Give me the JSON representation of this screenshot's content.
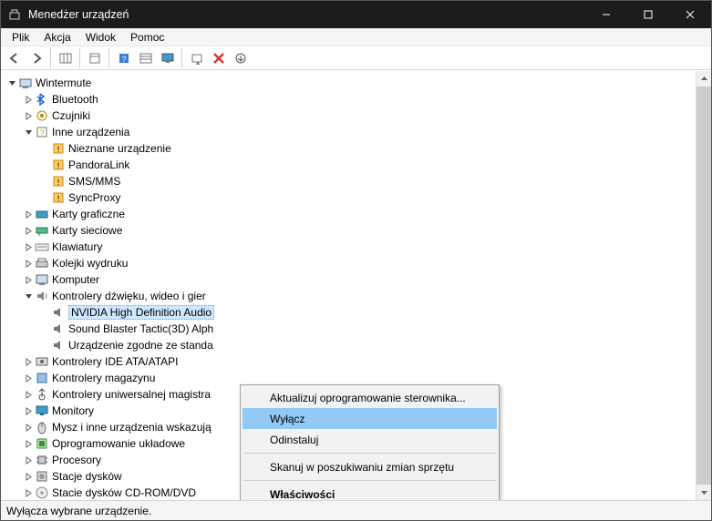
{
  "titlebar": {
    "title": "Menedżer urządzeń"
  },
  "menubar": {
    "items": [
      "Plik",
      "Akcja",
      "Widok",
      "Pomoc"
    ]
  },
  "toolbar": {
    "icons": [
      "nav-back",
      "nav-forward",
      "show-hide",
      "details",
      "help",
      "calendar",
      "monitor",
      "scan",
      "delete",
      "update"
    ]
  },
  "tree": {
    "root": {
      "label": "Wintermute",
      "expanded": true
    },
    "items": [
      {
        "icon": "bluetooth",
        "label": "Bluetooth",
        "indent": 1,
        "toggle": ">"
      },
      {
        "icon": "sensor",
        "label": "Czujniki",
        "indent": 1,
        "toggle": ">"
      },
      {
        "icon": "other",
        "label": "Inne urządzenia",
        "indent": 1,
        "toggle": "v"
      },
      {
        "icon": "unknown",
        "label": "Nieznane urządzenie",
        "indent": 2,
        "toggle": ""
      },
      {
        "icon": "unknown",
        "label": "PandoraLink",
        "indent": 2,
        "toggle": ""
      },
      {
        "icon": "unknown",
        "label": "SMS/MMS",
        "indent": 2,
        "toggle": ""
      },
      {
        "icon": "unknown",
        "label": "SyncProxy",
        "indent": 2,
        "toggle": ""
      },
      {
        "icon": "gpu",
        "label": "Karty graficzne",
        "indent": 1,
        "toggle": ">"
      },
      {
        "icon": "net",
        "label": "Karty sieciowe",
        "indent": 1,
        "toggle": ">"
      },
      {
        "icon": "keyboard",
        "label": "Klawiatury",
        "indent": 1,
        "toggle": ">"
      },
      {
        "icon": "printq",
        "label": "Kolejki wydruku",
        "indent": 1,
        "toggle": ">"
      },
      {
        "icon": "computer",
        "label": "Komputer",
        "indent": 1,
        "toggle": ">"
      },
      {
        "icon": "sound",
        "label": "Kontrolery dźwięku, wideo i gier",
        "indent": 1,
        "toggle": "v"
      },
      {
        "icon": "speaker",
        "label": "NVIDIA High Definition Audio",
        "indent": 2,
        "toggle": "",
        "selected": true
      },
      {
        "icon": "speaker",
        "label": "Sound Blaster Tactic(3D) Alph",
        "indent": 2,
        "toggle": "",
        "truncated": true
      },
      {
        "icon": "speaker",
        "label": "Urządzenie zgodne ze standa",
        "indent": 2,
        "toggle": "",
        "truncated": true
      },
      {
        "icon": "ide",
        "label": "Kontrolery IDE ATA/ATAPI",
        "indent": 1,
        "toggle": ">"
      },
      {
        "icon": "storage",
        "label": "Kontrolery magazynu",
        "indent": 1,
        "toggle": ">"
      },
      {
        "icon": "usb",
        "label": "Kontrolery uniwersalnej magistra",
        "indent": 1,
        "toggle": ">",
        "truncated": true
      },
      {
        "icon": "monitor",
        "label": "Monitory",
        "indent": 1,
        "toggle": ">"
      },
      {
        "icon": "mouse",
        "label": "Mysz i inne urządzenia wskazują",
        "indent": 1,
        "toggle": ">",
        "truncated": true
      },
      {
        "icon": "firmware",
        "label": "Oprogramowanie układowe",
        "indent": 1,
        "toggle": ">"
      },
      {
        "icon": "cpu",
        "label": "Procesory",
        "indent": 1,
        "toggle": ">"
      },
      {
        "icon": "disk",
        "label": "Stacje dysków",
        "indent": 1,
        "toggle": ">"
      },
      {
        "icon": "cdrom",
        "label": "Stacie dysków CD-ROM/DVD",
        "indent": 1,
        "toggle": ">",
        "cut": true
      }
    ]
  },
  "context_menu": {
    "items": [
      {
        "label": "Aktualizuj oprogramowanie sterownika...",
        "type": "item"
      },
      {
        "label": "Wyłącz",
        "type": "item",
        "hover": true
      },
      {
        "label": "Odinstaluj",
        "type": "item"
      },
      {
        "type": "sep"
      },
      {
        "label": "Skanuj w poszukiwaniu zmian sprzętu",
        "type": "item"
      },
      {
        "type": "sep"
      },
      {
        "label": "Właściwości",
        "type": "item",
        "bold": true
      }
    ]
  },
  "statusbar": {
    "text": "Wyłącza wybrane urządzenie."
  }
}
